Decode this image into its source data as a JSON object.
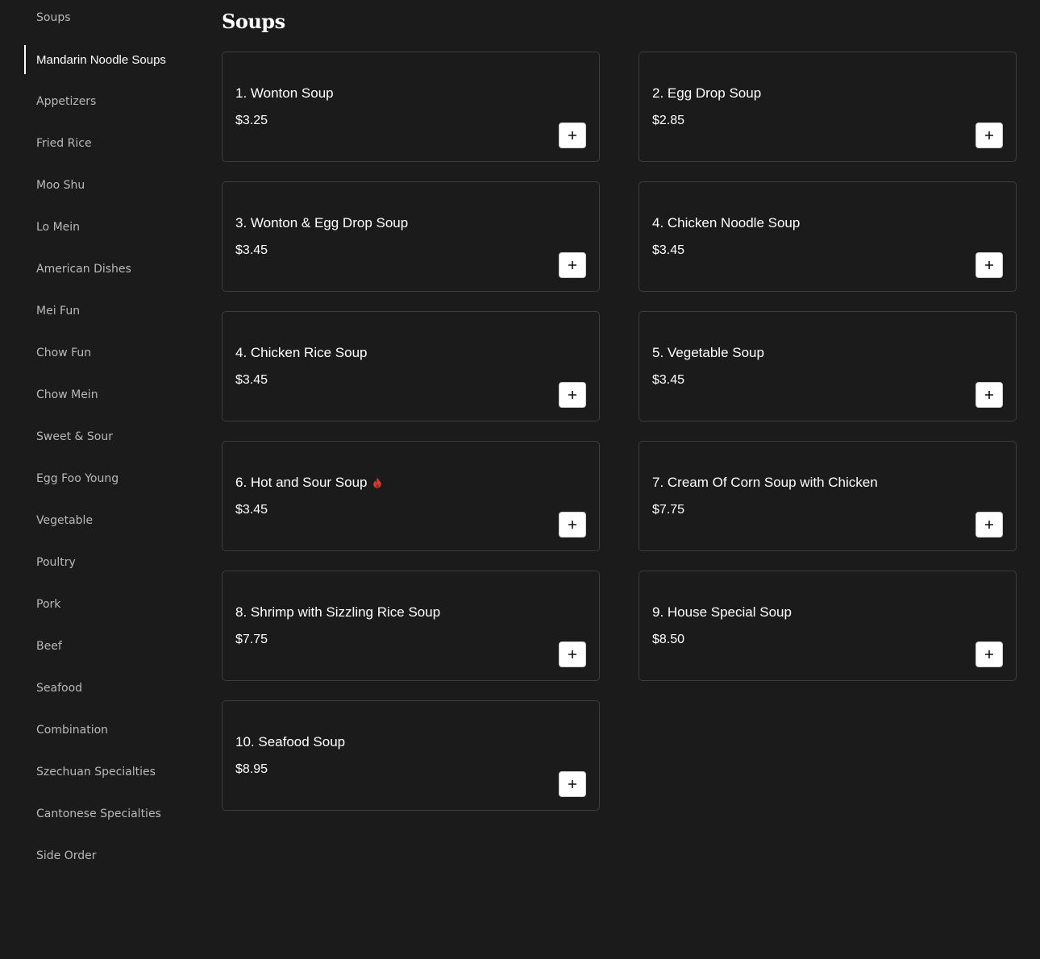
{
  "sidebar": {
    "items": [
      {
        "label": "Soups"
      },
      {
        "label": "Mandarin Noodle Soups",
        "active": true
      },
      {
        "label": "Appetizers"
      },
      {
        "label": "Fried Rice"
      },
      {
        "label": "Moo Shu"
      },
      {
        "label": "Lo Mein"
      },
      {
        "label": "American Dishes"
      },
      {
        "label": "Mei Fun"
      },
      {
        "label": "Chow Fun"
      },
      {
        "label": "Chow Mein"
      },
      {
        "label": "Sweet & Sour"
      },
      {
        "label": "Egg Foo Young"
      },
      {
        "label": "Vegetable"
      },
      {
        "label": "Poultry"
      },
      {
        "label": "Pork"
      },
      {
        "label": "Beef"
      },
      {
        "label": "Seafood"
      },
      {
        "label": "Combination"
      },
      {
        "label": "Szechuan Specialties"
      },
      {
        "label": "Cantonese Specialties"
      },
      {
        "label": "Side Order"
      }
    ]
  },
  "main": {
    "title": "Soups",
    "items": [
      {
        "name": "1. Wonton Soup",
        "price": "$3.25"
      },
      {
        "name": "2. Egg Drop Soup",
        "price": "$2.85"
      },
      {
        "name": "3. Wonton & Egg Drop Soup",
        "price": "$3.45"
      },
      {
        "name": "4. Chicken Noodle Soup",
        "price": "$3.45"
      },
      {
        "name": "4. Chicken Rice Soup",
        "price": "$3.45"
      },
      {
        "name": "5. Vegetable Soup",
        "price": "$3.45"
      },
      {
        "name": "6. Hot and Sour Soup",
        "price": "$3.45",
        "spicy": true
      },
      {
        "name": "7. Cream Of Corn Soup with Chicken",
        "price": "$7.75"
      },
      {
        "name": "8. Shrimp with Sizzling Rice Soup",
        "price": "$7.75"
      },
      {
        "name": "9. House Special Soup",
        "price": "$8.50"
      },
      {
        "name": "10. Seafood Soup",
        "price": "$8.95"
      }
    ]
  },
  "icons": {
    "add": "plus-icon",
    "spicy": "flame-icon"
  },
  "colors": {
    "background": "#1b1b1b",
    "spicy": "#d93a2b"
  }
}
